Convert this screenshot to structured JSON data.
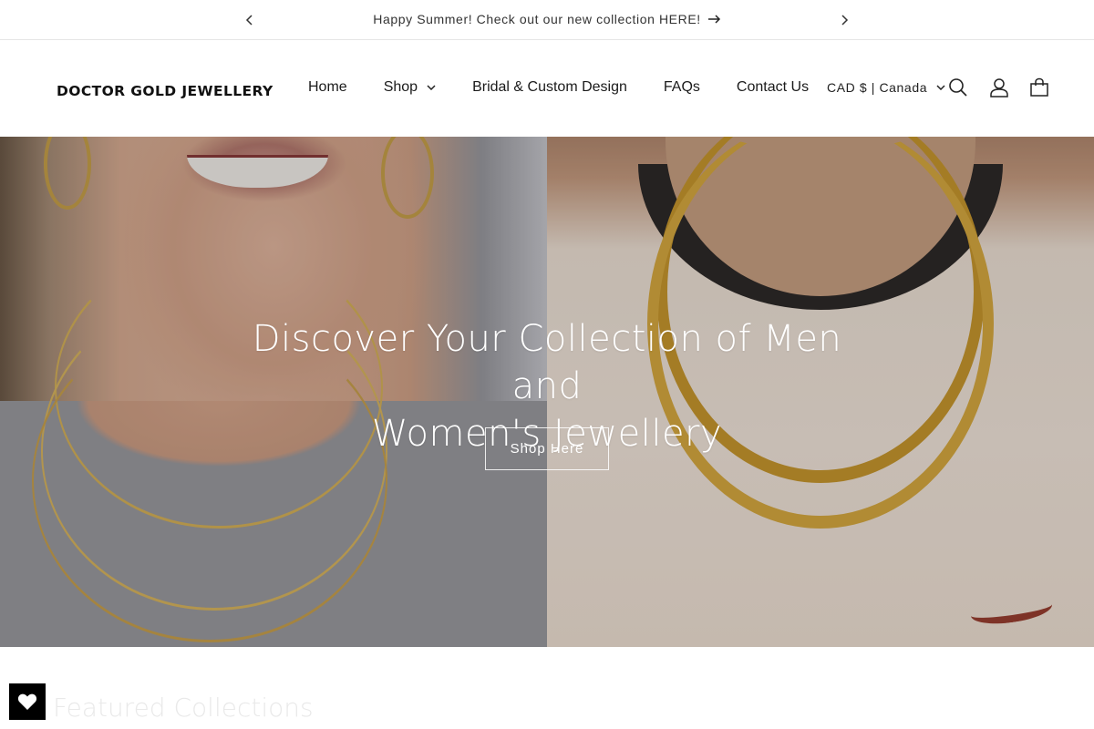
{
  "announcement": {
    "text": "Happy Summer! Check out our new collection HERE!"
  },
  "header": {
    "logo": "DOCTOR GOLD JEWELLERY",
    "nav": [
      {
        "label": "Home"
      },
      {
        "label": "Shop"
      },
      {
        "label": "Bridal & Custom Design"
      },
      {
        "label": "FAQs"
      },
      {
        "label": "Contact Us"
      }
    ],
    "country": "CAD $ | Canada"
  },
  "hero": {
    "heading_line1": "Discover Your Collection of Men and",
    "heading_line2": "Women's Jewellery",
    "cta": "Shop Here"
  },
  "featured": {
    "title": "Featured Collections"
  },
  "icons": {
    "prev": "chevron-left-icon",
    "next": "chevron-right-icon",
    "announce_arrow": "arrow-right-icon",
    "search": "search-icon",
    "account": "account-icon",
    "cart": "cart-icon",
    "wishlist": "heart-icon"
  }
}
